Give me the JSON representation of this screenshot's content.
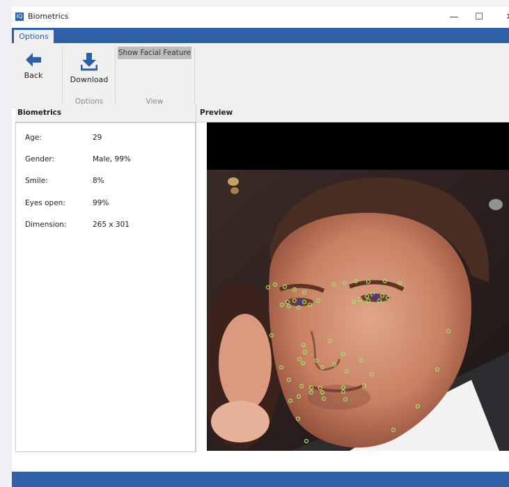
{
  "window": {
    "title": "Biometrics",
    "app_icon": "IQ"
  },
  "window_controls": {
    "minimize": "—",
    "maximize": "☐",
    "close": "✕"
  },
  "ribbon": {
    "tab": "Options",
    "back_label": "Back",
    "download_label": "Download",
    "options_group_label": "Options",
    "show_facial_feature_label": "Show Facial Feature",
    "view_group_label": "View"
  },
  "biometrics_panel": {
    "title": "Biometrics",
    "rows": [
      {
        "label": "Age:",
        "value": "29"
      },
      {
        "label": "Gender:",
        "value": "Male, 99%"
      },
      {
        "label": "Smile:",
        "value": "8%"
      },
      {
        "label": "Eyes open:",
        "value": "99%"
      },
      {
        "label": "Dimension:",
        "value": "265 x 301"
      }
    ]
  },
  "preview_panel": {
    "title": "Preview"
  },
  "colors": {
    "accent": "#2e60a8",
    "landmark": "#9be36a",
    "pupil": "#3b2fd6"
  }
}
